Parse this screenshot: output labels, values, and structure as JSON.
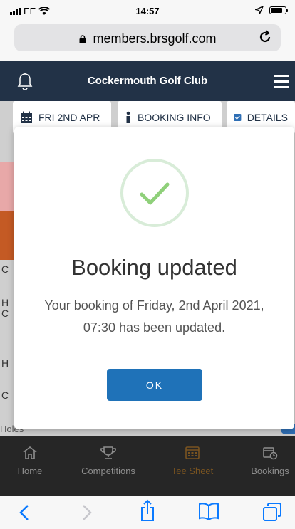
{
  "status_bar": {
    "carrier": "EE",
    "time": "14:57"
  },
  "browser": {
    "url": "members.brsgolf.com"
  },
  "app": {
    "title": "Cockermouth Golf Club"
  },
  "header_tabs": [
    {
      "label": "FRI 2ND APR",
      "icon": "calendar-icon"
    },
    {
      "label": "BOOKING INFO",
      "icon": "info-icon"
    },
    {
      "label": "DETAILS",
      "icon": "checkbox-icon"
    }
  ],
  "background": {
    "side_letters": [
      "C",
      "H",
      "C",
      "H",
      "C"
    ],
    "holes_label": "Holes"
  },
  "modal": {
    "title": "Booking updated",
    "message": "Your booking of Friday, 2nd April 2021, 07:30 has been updated.",
    "ok_label": "OK"
  },
  "tab_bar": {
    "items": [
      {
        "label": "Home",
        "icon": "home-icon",
        "active": false
      },
      {
        "label": "Competitions",
        "icon": "trophy-icon",
        "active": false
      },
      {
        "label": "Tee Sheet",
        "icon": "tee-sheet-icon",
        "active": true
      },
      {
        "label": "Bookings",
        "icon": "bookings-calendar-icon",
        "active": false
      }
    ]
  },
  "colors": {
    "header_bg": "#223247",
    "primary_button": "#1f72b8",
    "success_check": "#8fd07a",
    "tab_active": "#7a5420",
    "ios_blue": "#0a7aff"
  }
}
